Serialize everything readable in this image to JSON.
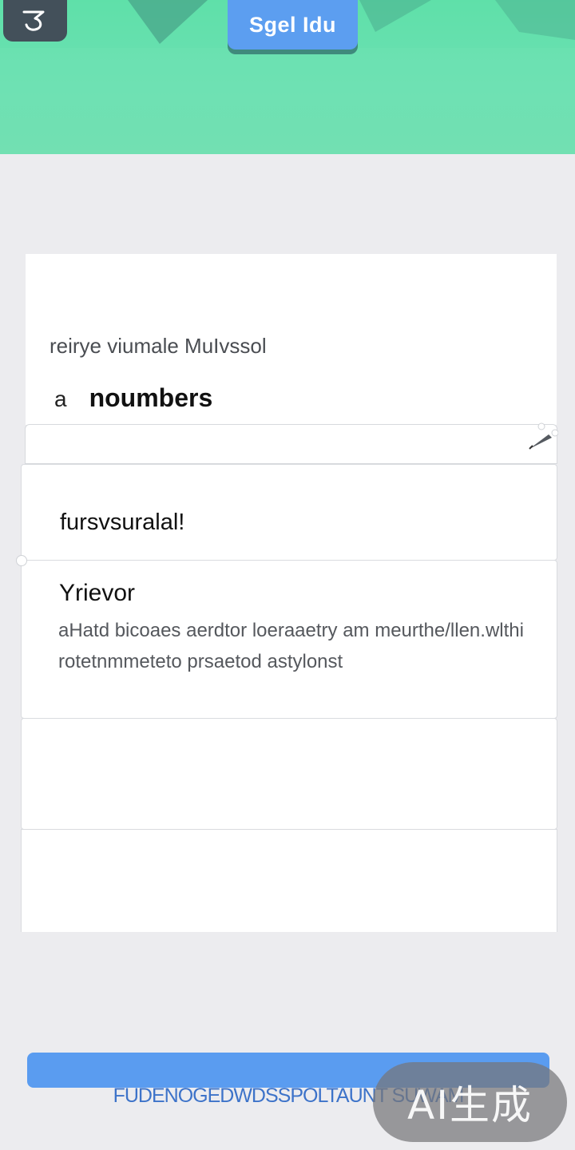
{
  "header": {
    "title": "Sgel Idu",
    "back_icon": "back-arrow-icon",
    "colors": {
      "header_green": "#6be0b2",
      "title_pill": "#5c9ef0",
      "back_button": "#43505a"
    }
  },
  "question": {
    "subtitle": "reirye viumale MuIvssol",
    "answer_prefix": "a",
    "answer_value": "noumbers"
  },
  "input": {
    "value": "",
    "edit_icon": "pen-icon"
  },
  "options": [
    {
      "label": "fursvsuralal!"
    },
    {
      "title": "Yrievor",
      "description": "aHatd bicoaes aerdtor loeraaetry am meurthe/llen.wlthi rotetnmmeteto prsaetod astylonst"
    },
    {
      "label": ""
    },
    {
      "label": ""
    }
  ],
  "footer": {
    "button_label": "",
    "caption": "FUDENOGEDWDSSPOLTAUNT SUWAM",
    "accent": "#5a9cf0"
  },
  "watermark": {
    "text": "AI生成"
  }
}
